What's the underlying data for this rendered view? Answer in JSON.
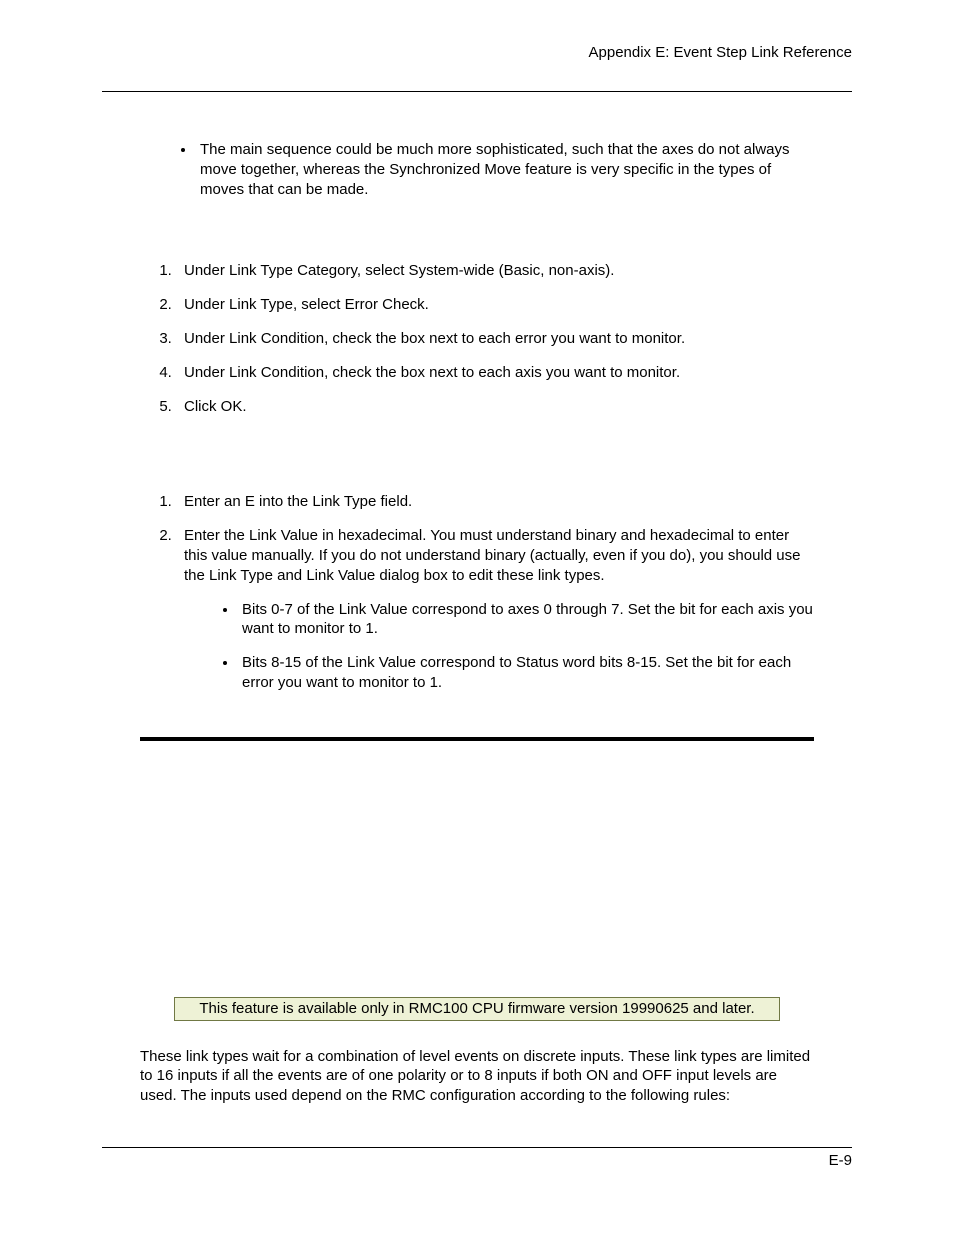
{
  "header": {
    "title": "Appendix E:  Event Step Link Reference"
  },
  "bullet1": "The main sequence could be much more sophisticated, such that the axes do not always move together, whereas the Synchronized Move feature is very specific in the types of moves that can be made.",
  "list1": {
    "i1": "Under Link Type Category, select System-wide (Basic, non-axis).",
    "i2": "Under Link Type, select Error Check.",
    "i3": "Under Link Condition, check the box next to each error you want to monitor.",
    "i4": "Under Link Condition, check the box next to each axis you want to monitor.",
    "i5": "Click OK."
  },
  "list2": {
    "i1": "Enter an E into the Link Type field.",
    "i2": "Enter the Link Value in hexadecimal. You must understand binary and hexadecimal to enter this value manually. If you do not understand binary (actually, even if you do), you should use the Link Type and Link Value dialog box to edit these link types.",
    "sub1": "Bits 0-7 of the Link Value correspond to axes 0 through 7. Set the bit for each axis you want to monitor to 1.",
    "sub2": "Bits 8-15 of the Link Value correspond to Status word bits 8-15. Set the bit for each error you want to monitor to 1."
  },
  "note": "This feature is available only in RMC100 CPU firmware version 19990625 and later.",
  "para": "These link types wait for a combination of level events on discrete inputs. These link types are limited to 16 inputs if all the events are of one polarity or to 8 inputs if both ON and OFF input levels are used. The inputs used depend on the RMC configuration according to the following rules:",
  "footer": {
    "page": "E-9"
  }
}
